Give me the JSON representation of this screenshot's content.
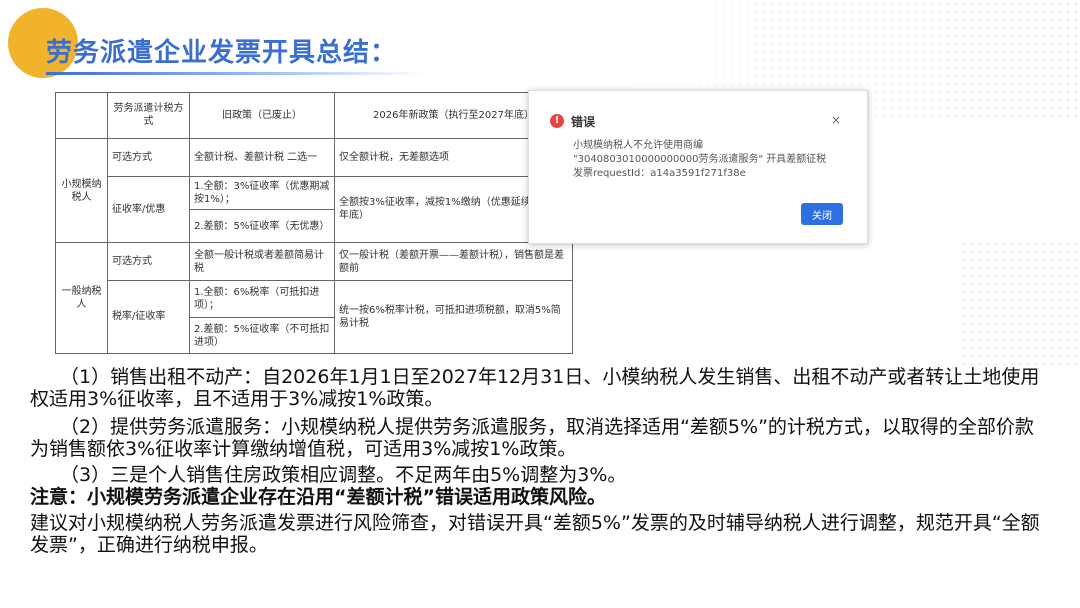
{
  "slide": {
    "title": "劳务派遣企业发票开具总结："
  },
  "table": {
    "headers": [
      "",
      "劳务派遣计税方式",
      "旧政策（已废止）",
      "2026年新政策（执行至2027年底）"
    ],
    "small": {
      "label": "小规模纳税人",
      "row1": {
        "col1": "可选方式",
        "old": "全额计税、差额计税 二选一",
        "new": "仅全额计税，无差额选项"
      },
      "row2": {
        "col1": "征收率/优惠",
        "old1": "1.全额：3%征收率（优惠期减按1%）；",
        "old2": "2.差额：5%征收率（无优惠）",
        "new": "全额按3%征收率，减按1%缴纳（优惠延续至2027年底）"
      }
    },
    "general": {
      "label": "一般纳税人",
      "row1": {
        "col1": "可选方式",
        "old": "全额一般计税或者差额简易计税",
        "new": "仅一般计税（差额开票——差额计税），销售额是差额前"
      },
      "row2": {
        "col1": "税率/征收率",
        "old1": "1.全额：6%税率（可抵扣进项）；",
        "old2": "2.差额：5%征收率（不可抵扣进项）",
        "new": "统一按6%税率计税，可抵扣进项税额，取消5%简易计税"
      }
    }
  },
  "dialog": {
    "title": "错误",
    "close_label": "×",
    "icon_glyph": "!",
    "message": "小规模纳税人不允许使用商编 \"3040803010000000000劳务派遣服务\" 开具差额征税发票requestId：a14a3591f271f38e",
    "ok_label": "关闭"
  },
  "paragraphs": {
    "p1": "（1）销售出租不动产：自2026年1月1日至2027年12月31日、小模纳税人发生销售、出租不动产或者转让土地使用权适用3%征收率，且不适用于3%减按1%政策。",
    "p2": "（2）提供劳务派遣服务：小规模纳税人提供劳务派遣服务，取消选择适用“差额5%”的计税方式，以取得的全部价款为销售额依3%征收率计算缴纳增值税，可适用3%减按1%政策。",
    "p3": "（3）三是个人销售住房政策相应调整。不足两年由5%调整为3%。",
    "note": "注意：小规模劳务派遣企业存在沿用“差额计税”错误适用政策风险。",
    "p4": "建议对小规模纳税人劳务派遣发票进行风险筛查，对错误开具“差额5%”发票的及时辅导纳税人进行调整，规范开具“全额发票”，正确进行纳税申报。"
  },
  "colors": {
    "title_blue": "#3a6fd0",
    "accent_orange": "#f1b22c",
    "error_red": "#e64545",
    "button_blue": "#2f6fe4"
  }
}
